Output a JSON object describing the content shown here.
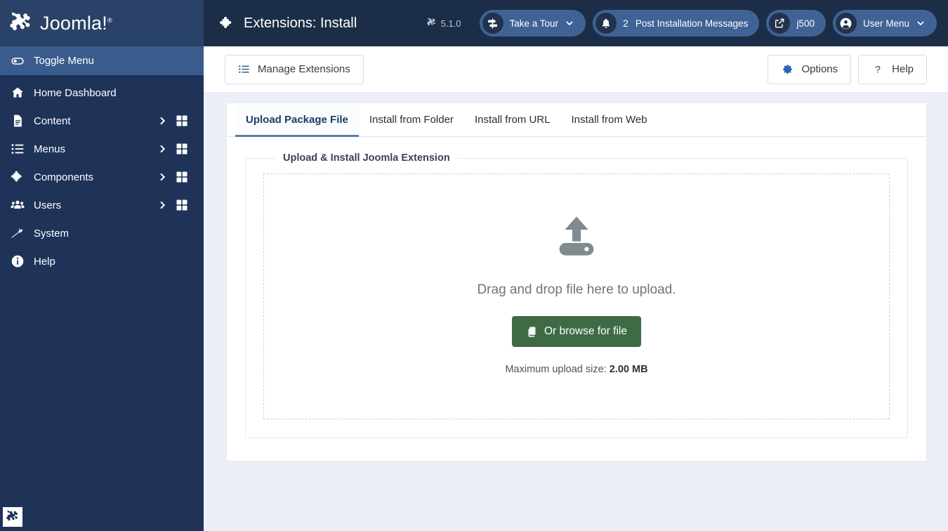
{
  "brand": {
    "name": "Joomla!",
    "trademark": "®",
    "logo_icon": "joomla-logo-icon"
  },
  "sidebar": {
    "toggle": {
      "label": "Toggle Menu",
      "icon": "toggle-switch-icon"
    },
    "items": [
      {
        "label": "Home Dashboard",
        "icon": "home-icon",
        "has_submenu": false,
        "has_dashboard": false
      },
      {
        "label": "Content",
        "icon": "document-icon",
        "has_submenu": true,
        "has_dashboard": true
      },
      {
        "label": "Menus",
        "icon": "list-icon",
        "has_submenu": true,
        "has_dashboard": true
      },
      {
        "label": "Components",
        "icon": "puzzle-icon",
        "has_submenu": true,
        "has_dashboard": true
      },
      {
        "label": "Users",
        "icon": "users-icon",
        "has_submenu": true,
        "has_dashboard": true
      },
      {
        "label": "System",
        "icon": "wrench-icon",
        "has_submenu": false,
        "has_dashboard": false
      },
      {
        "label": "Help",
        "icon": "info-circle-icon",
        "has_submenu": false,
        "has_dashboard": false
      }
    ],
    "footer_icon": "joomla-mark-icon"
  },
  "header": {
    "title": "Extensions: Install",
    "title_icon": "puzzle-icon",
    "version": "5.1.0",
    "version_icon": "joomla-mark-icon",
    "tour": {
      "label": "Take a Tour",
      "icon": "signpost-icon",
      "chevron": "chevron-down-icon"
    },
    "notifications": {
      "count": "2",
      "label": "Post Installation Messages",
      "icon": "bell-icon"
    },
    "site": {
      "label": "j500",
      "icon": "external-link-icon"
    },
    "user_menu": {
      "label": "User Menu",
      "icon": "user-circle-icon",
      "chevron": "chevron-down-icon"
    }
  },
  "toolbar": {
    "manage_label": "Manage Extensions",
    "manage_icon": "list-icon",
    "options_label": "Options",
    "options_icon": "gear-icon",
    "help_label": "Help",
    "help_icon": "question-mark-icon"
  },
  "tabs": [
    {
      "label": "Upload Package File",
      "active": true
    },
    {
      "label": "Install from Folder",
      "active": false
    },
    {
      "label": "Install from URL",
      "active": false
    },
    {
      "label": "Install from Web",
      "active": false
    }
  ],
  "upload": {
    "legend": "Upload & Install Joomla Extension",
    "drop_icon": "upload-icon",
    "drop_text": "Drag and drop file here to upload.",
    "browse_label": "Or browse for file",
    "browse_icon": "files-icon",
    "max_size_label": "Maximum upload size:",
    "max_size_value": "2.00 MB"
  },
  "colors": {
    "sidebar_bg": "#1f3359",
    "sidebar_brand_bg": "#2b4268",
    "sidebar_active": "#3a5c8c",
    "header_bg": "#1c2e47",
    "pill_bg": "#3f6394",
    "page_bg": "#eceff7",
    "accent_green": "#3e6b44",
    "tab_active_border": "#5b7ea4",
    "gear_blue": "#2c63b4"
  }
}
